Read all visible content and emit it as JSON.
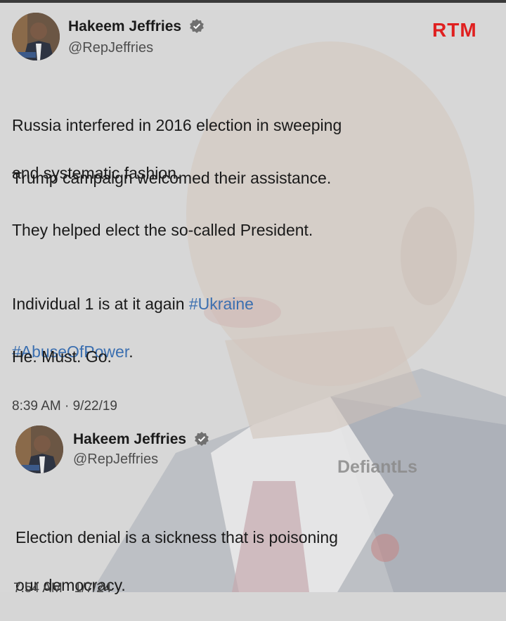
{
  "brand": {
    "rtm_label": "RTM",
    "rtm_color": "#e02020",
    "watermark": "DefiantLs"
  },
  "tweet1": {
    "author_name": "Hakeem Jeffries",
    "handle": "@RepJeffries",
    "para1_line1": "Russia interfered in 2016 election in sweeping",
    "para1_line2": "and systematic fashion.",
    "para2": "Trump campaign welcomed their assistance.",
    "para3": "They helped elect the so-called President.",
    "para4_text": "Individual 1 is at it again ",
    "para4_tag1": "#Ukraine",
    "para4_tag2": "#AbuseOfPower",
    "para4_end": ".",
    "para5": "He. Must. Go.",
    "timestamp": "8:39 AM · 9/22/19"
  },
  "tweet2": {
    "author_name": "Hakeem Jeffries",
    "handle": "@RepJeffries",
    "line1": "Election denial is a sickness that is poisoning",
    "line2": "our democracy.",
    "timestamp": "7:54 AM · 1/7/24"
  },
  "icons": {
    "verified": "verified-badge-icon",
    "avatar": "profile-avatar"
  },
  "colors": {
    "hashtag": "#3b6fb0",
    "background": "#d6d6d6"
  }
}
